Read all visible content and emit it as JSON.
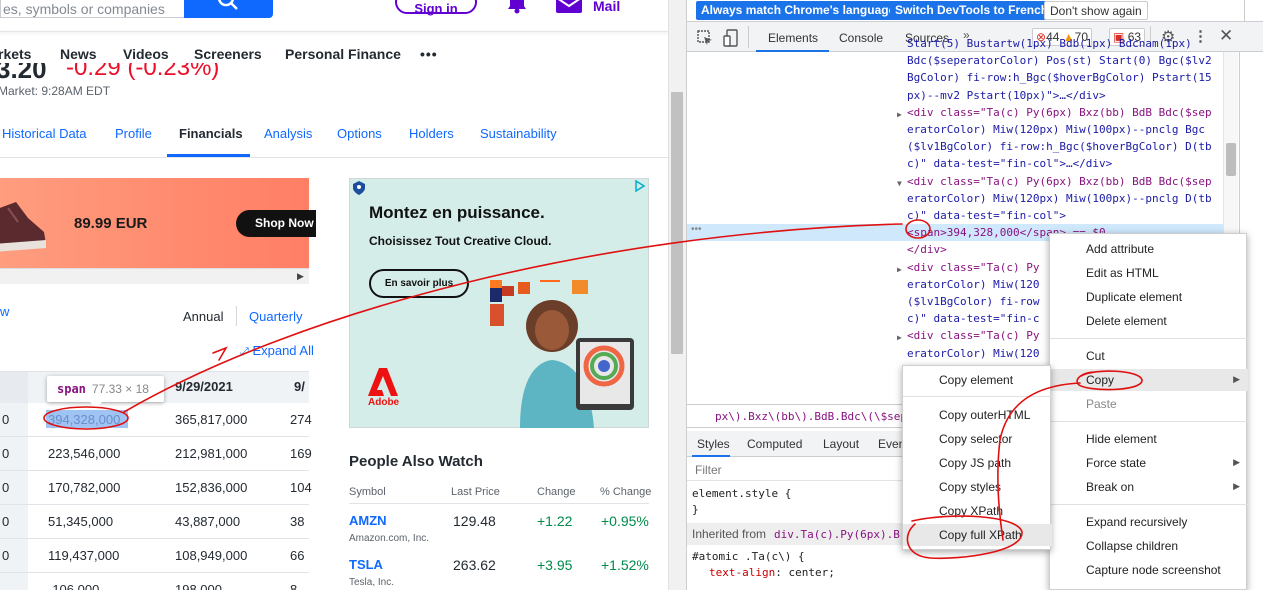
{
  "yahoo": {
    "search_placeholder": "es, symbols or companies",
    "signin": "Sign in",
    "mail": "Mail",
    "nav": [
      "rkets",
      "News",
      "Videos",
      "Screeners",
      "Personal Finance",
      "•••"
    ],
    "quote_price": "3.20",
    "quote_change": "-0.29 (-0.23%)",
    "market_time": "Market: 9:28AM EDT",
    "tabs": [
      "Historical Data",
      "Profile",
      "Financials",
      "Analysis",
      "Options",
      "Holders",
      "Sustainability"
    ],
    "ad1": {
      "price": "89.99 EUR",
      "button": "Shop Now"
    },
    "period": {
      "annual": "Annual",
      "quarterly": "Quarterly"
    },
    "expand_all": "Expand All",
    "w_link": "w",
    "tooltip": {
      "tag": "span",
      "size": "77.33 × 18"
    },
    "table": {
      "headers": [
        "9/29/2021",
        "9/"
      ],
      "rows": [
        [
          "0",
          "394,328,000",
          "365,817,000",
          "274"
        ],
        [
          "0",
          "223,546,000",
          "212,981,000",
          "169"
        ],
        [
          "0",
          "170,782,000",
          "152,836,000",
          "104"
        ],
        [
          "0",
          "51,345,000",
          "43,887,000",
          "38"
        ],
        [
          "0",
          "119,437,000",
          "108,949,000",
          "66"
        ],
        [
          "",
          "-106,000",
          "198,000",
          "8"
        ]
      ]
    },
    "ad2": {
      "title": "Montez en puissance.",
      "subtitle": "Choisissez Tout Creative Cloud.",
      "button": "En savoir plus",
      "brand": "Adobe"
    },
    "people_also_watch": {
      "title": "People Also Watch",
      "headers": [
        "Symbol",
        "Last Price",
        "Change",
        "% Change"
      ],
      "rows": [
        {
          "symbol": "AMZN",
          "name": "Amazon.com, Inc.",
          "price": "129.48",
          "change": "+1.22",
          "pct": "+0.95%"
        },
        {
          "symbol": "TSLA",
          "name": "Tesla, Inc.",
          "price": "263.62",
          "change": "+3.95",
          "pct": "+1.52%"
        }
      ]
    }
  },
  "devtools": {
    "infobar": {
      "match_language": "Always match Chrome's language",
      "switch_french": "Switch DevTools to French",
      "dont_show": "Don't show again"
    },
    "tabs": [
      "Elements",
      "Console",
      "Sources"
    ],
    "errors": "44",
    "warnings": "70",
    "issues": "63",
    "code_lines": [
      "Start(5) Bustartw(1px) Bdb(1px) Bdcnam(1px)",
      "Bdc($seperatorColor) Pos(st) Start(0) Bgc($lv2",
      "BgColor) fi-row:h_Bgc($hoverBgColor) Pstart(15",
      "px)--mv2 Pstart(10px)\">…</div>",
      "<div class=\"Ta(c) Py(6px) Bxz(bb) BdB Bdc($sep",
      "eratorColor) Miw(120px) Miw(100px)--pnclg Bgc",
      "($lv1BgColor) fi-row:h_Bgc($hoverBgColor) D(tb",
      "c)\" data-test=\"fin-col\">…</div>",
      "<div class=\"Ta(c) Py(6px) Bxz(bb) BdB Bdc($sep",
      "eratorColor) Miw(120px) Miw(100px)--pnclg D(tb",
      "c)\" data-test=\"fin-col\">",
      "<span>394,328,000</span> == $0",
      "</div>",
      "<div class=\"Ta(c) Py",
      "eratorColor) Miw(120",
      "($lv1BgColor) fi-row",
      "c)\" data-test=\"fin-c",
      "<div class=\"Ta(c) Py",
      "eratorColor) Miw(120"
    ],
    "breadcrumb": "px\\).Bxz\\(bb\\).BdB.Bdc\\(\\$seperato",
    "styles_tabs": [
      "Styles",
      "Computed",
      "Layout",
      "Even"
    ],
    "filter": "Filter",
    "element_style": "element.style {",
    "brace": "}",
    "inherited_label": "Inherited from",
    "inherited_sel": "div.Ta(c).Py(6px).B",
    "rule_selector": "#atomic .Ta(c\\) {",
    "rule_prop": "text-align",
    "rule_val": "center;"
  },
  "context_menu": {
    "items": [
      "Add attribute",
      "Edit as HTML",
      "Duplicate element",
      "Delete element",
      "Cut",
      "Copy",
      "Paste",
      "Hide element",
      "Force state",
      "Break on",
      "Expand recursively",
      "Collapse children",
      "Capture node screenshot"
    ]
  },
  "copy_submenu": {
    "items": [
      "Copy element",
      "Copy outerHTML",
      "Copy selector",
      "Copy JS path",
      "Copy styles",
      "Copy XPath",
      "Copy full XPath"
    ]
  },
  "colors": {
    "yahoo_blue": "#0f69ff",
    "yahoo_purple": "#6001d2",
    "red_down": "#eb0f29",
    "green_up": "#008a4b",
    "annotation_red": "#e01010"
  }
}
